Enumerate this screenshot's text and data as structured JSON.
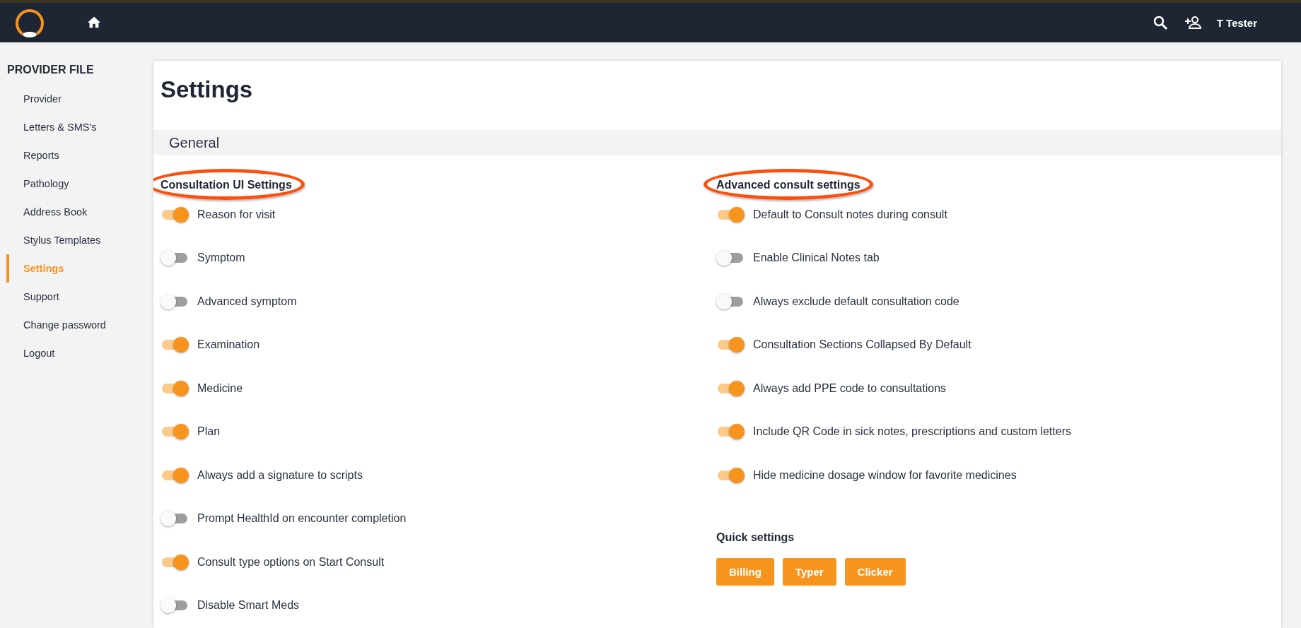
{
  "topbar": {
    "user": "T Tester"
  },
  "sidebar": {
    "title": "PROVIDER FILE",
    "items": [
      {
        "label": "Provider",
        "selected": false
      },
      {
        "label": "Letters & SMS's",
        "selected": false
      },
      {
        "label": "Reports",
        "selected": false
      },
      {
        "label": "Pathology",
        "selected": false
      },
      {
        "label": "Address Book",
        "selected": false
      },
      {
        "label": "Stylus Templates",
        "selected": false
      },
      {
        "label": "Settings",
        "selected": true
      },
      {
        "label": "Support",
        "selected": false
      },
      {
        "label": "Change password",
        "selected": false
      },
      {
        "label": "Logout",
        "selected": false
      }
    ]
  },
  "page": {
    "title": "Settings",
    "section": "General"
  },
  "columns": [
    {
      "heading": "Consultation UI Settings",
      "highlighted": true,
      "toggles": [
        {
          "label": "Reason for visit",
          "on": true
        },
        {
          "label": "Symptom",
          "on": false
        },
        {
          "label": "Advanced symptom",
          "on": false
        },
        {
          "label": "Examination",
          "on": true
        },
        {
          "label": "Medicine",
          "on": true
        },
        {
          "label": "Plan",
          "on": true
        },
        {
          "label": "Always add a signature to scripts",
          "on": true
        },
        {
          "label": "Prompt HealthId on encounter completion",
          "on": false
        },
        {
          "label": "Consult type options on Start Consult",
          "on": true
        },
        {
          "label": "Disable Smart Meds",
          "on": false
        }
      ]
    },
    {
      "heading": "Advanced consult settings",
      "highlighted": true,
      "toggles": [
        {
          "label": "Default to Consult notes during consult",
          "on": true
        },
        {
          "label": "Enable Clinical Notes tab",
          "on": false
        },
        {
          "label": "Always exclude default consultation code",
          "on": false
        },
        {
          "label": "Consultation Sections Collapsed By Default",
          "on": true
        },
        {
          "label": "Always add PPE code to consultations",
          "on": true
        },
        {
          "label": "Include QR Code in sick notes, prescriptions and custom letters",
          "on": true
        },
        {
          "label": "Hide medicine dosage window for favorite medicines",
          "on": true
        }
      ],
      "quick": {
        "heading": "Quick settings",
        "buttons": [
          "Billing",
          "Typer",
          "Clicker"
        ]
      }
    }
  ]
}
